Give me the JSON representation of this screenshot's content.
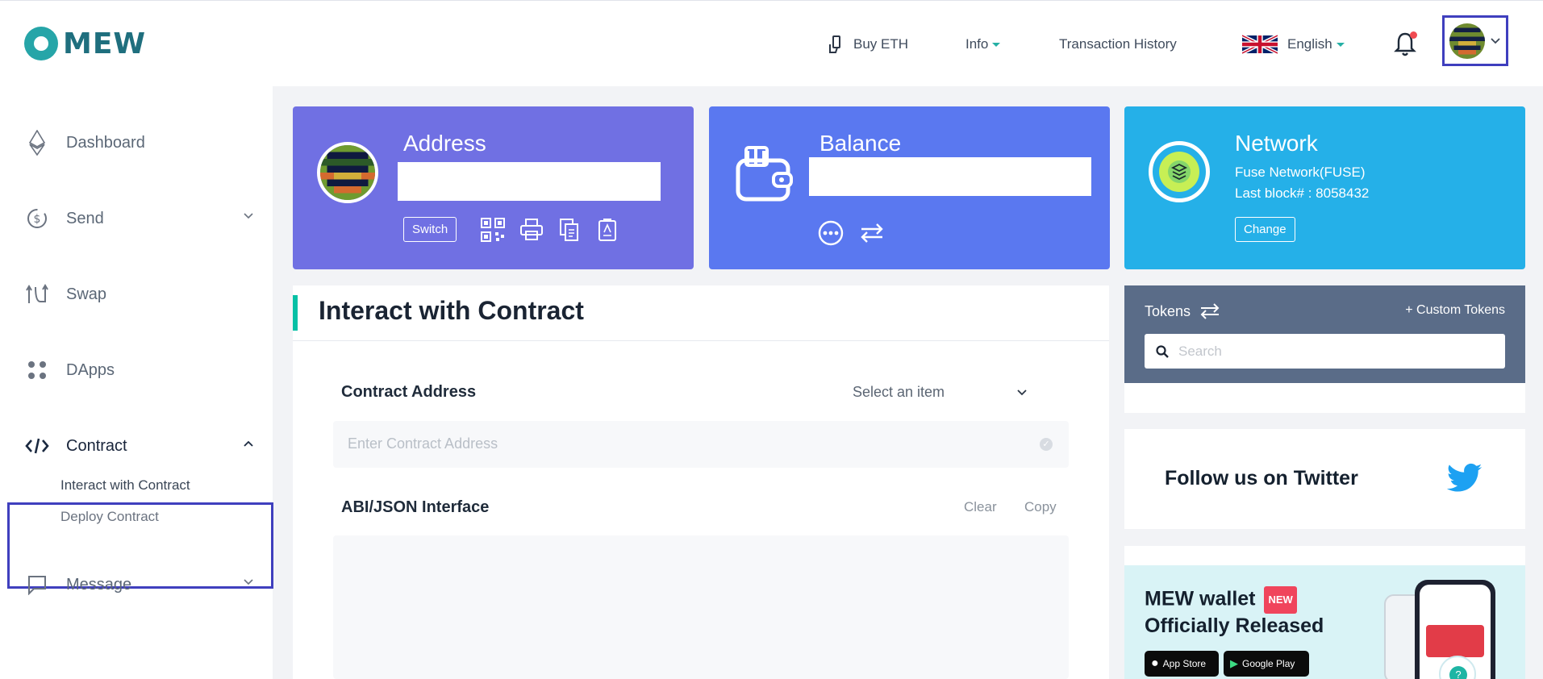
{
  "header": {
    "logo_text": "MEW",
    "buy_eth": "Buy ETH",
    "info": "Info",
    "transaction_history": "Transaction History",
    "language": "English"
  },
  "sidebar": {
    "items": [
      {
        "label": "Dashboard",
        "icon": "ethereum-icon"
      },
      {
        "label": "Send",
        "icon": "send-icon"
      },
      {
        "label": "Swap",
        "icon": "swap-icon"
      },
      {
        "label": "DApps",
        "icon": "dapps-icon"
      },
      {
        "label": "Contract",
        "icon": "code-icon"
      },
      {
        "label": "Message",
        "icon": "message-icon"
      }
    ],
    "contract_sub": [
      "Interact with Contract",
      "Deploy Contract"
    ]
  },
  "cards": {
    "address": {
      "title": "Address",
      "switch_label": "Switch"
    },
    "balance": {
      "title": "Balance"
    },
    "network": {
      "title": "Network",
      "name": "Fuse Network(FUSE)",
      "last_block": "Last block# : 8058432",
      "change_label": "Change"
    }
  },
  "interact": {
    "title": "Interact with Contract",
    "contract_address_label": "Contract Address",
    "select_placeholder": "Select an item",
    "address_placeholder": "Enter Contract Address",
    "abi_label": "ABI/JSON Interface",
    "clear_label": "Clear",
    "copy_label": "Copy"
  },
  "tokens": {
    "title": "Tokens",
    "custom_tokens": "+ Custom Tokens",
    "search_placeholder": "Search"
  },
  "twitter": {
    "label": "Follow us on Twitter"
  },
  "promo": {
    "line1": "MEW wallet",
    "badge": "NEW",
    "line2": "Officially Released",
    "app_store": "App Store",
    "google_play": "Google Play"
  },
  "colors": {
    "accent": "#05c0a5",
    "address_card": "#7070e3",
    "balance_card": "#5a78f0",
    "network_card": "#25b0e8",
    "highlight_border": "#3f3fbe"
  }
}
